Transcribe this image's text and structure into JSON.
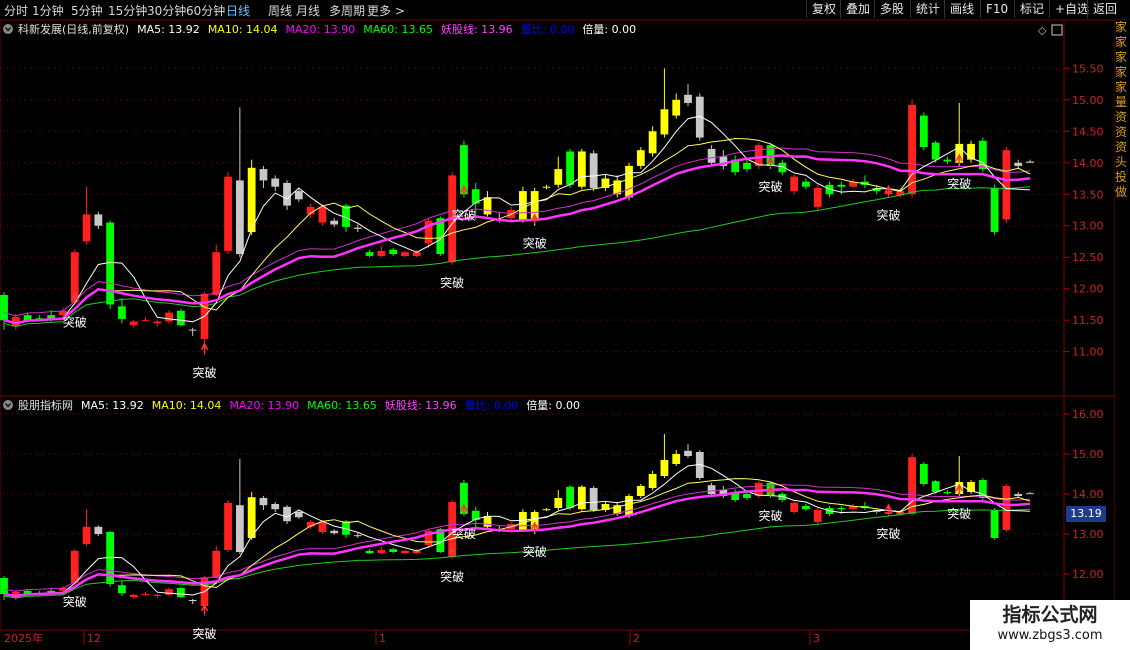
{
  "toolbar": {
    "periods": [
      "分时",
      "1分钟",
      "5分钟",
      "15分钟",
      "30分钟",
      "60分钟",
      "日线",
      "周线",
      "月线",
      "多周期",
      "更多 >"
    ],
    "active_period": "日线",
    "right_buttons": [
      "复权",
      "叠加",
      "多股",
      "统计",
      "画线",
      "F10",
      "标记",
      "+自选",
      "返回"
    ]
  },
  "main_panel": {
    "title": "科新发展(日线,前复权)",
    "indicators": [
      {
        "label": "MA5: 13.92",
        "color": "#ffffff"
      },
      {
        "label": "MA10: 14.04",
        "color": "#ffff00"
      },
      {
        "label": "MA20: 13.90",
        "color": "#ff00ff"
      },
      {
        "label": "MA60: 13.65",
        "color": "#00ff00"
      },
      {
        "label": "妖股线: 13.96",
        "color": "#ff44ff"
      },
      {
        "label": "量比: 0.00",
        "color": "#0000ff"
      },
      {
        "label": "倍量: 0.00",
        "color": "#ffffff"
      }
    ],
    "y_ticks": [
      "15.50",
      "15.00",
      "14.50",
      "14.00",
      "13.50",
      "13.00",
      "12.50",
      "12.00",
      "11.50",
      "11.00"
    ]
  },
  "sub_panel": {
    "title": "股朋指标网",
    "indicators": [
      {
        "label": "MA5: 13.92",
        "color": "#ffffff"
      },
      {
        "label": "MA10: 14.04",
        "color": "#ffff00"
      },
      {
        "label": "MA20: 13.90",
        "color": "#ff00ff"
      },
      {
        "label": "MA60: 13.65",
        "color": "#00ff00"
      },
      {
        "label": "妖股线: 13.96",
        "color": "#ff44ff"
      },
      {
        "label": "量比: 0.00",
        "color": "#0000ff"
      },
      {
        "label": "倍量: 0.00",
        "color": "#ffffff"
      }
    ],
    "y_ticks": [
      "16.00",
      "15.00",
      "14.00",
      "13.00",
      "12.00"
    ],
    "price_tag": "13.19"
  },
  "breakout_label": "突破",
  "x_axis": {
    "year_label": "2025年",
    "months": [
      "12",
      "1",
      "2",
      "3"
    ]
  },
  "side_text": [
    "家",
    "家",
    "家",
    "家",
    "家",
    "量",
    "资",
    "资",
    "资",
    "头",
    "投",
    "做"
  ],
  "watermark": {
    "line1": "指标公式网",
    "line2": "www.zbgs3.com"
  },
  "chart_data": {
    "type": "candlestick",
    "candles": [
      [
        11.9,
        11.5,
        11.95,
        11.35,
        "g"
      ],
      [
        11.55,
        11.4,
        11.6,
        11.35,
        "r"
      ],
      [
        11.5,
        11.58,
        11.62,
        11.48,
        "g"
      ],
      [
        11.53,
        11.52,
        11.58,
        11.5,
        "g"
      ],
      [
        11.52,
        11.58,
        11.66,
        11.48,
        "g"
      ],
      [
        11.65,
        11.58,
        11.7,
        11.55,
        "r"
      ],
      [
        11.78,
        12.58,
        12.62,
        11.75,
        "r"
      ],
      [
        12.75,
        13.18,
        13.62,
        12.7,
        "r"
      ],
      [
        13.18,
        13.0,
        13.22,
        12.95,
        "w"
      ],
      [
        13.05,
        11.75,
        13.08,
        11.68,
        "g"
      ],
      [
        11.72,
        11.52,
        11.85,
        11.45,
        "g"
      ],
      [
        11.42,
        11.48,
        11.5,
        11.38,
        "r"
      ],
      [
        11.5,
        11.5,
        11.55,
        11.48,
        "r"
      ],
      [
        11.45,
        11.48,
        11.5,
        11.4,
        "r"
      ],
      [
        11.48,
        11.62,
        11.66,
        11.45,
        "r"
      ],
      [
        11.65,
        11.42,
        11.68,
        11.4,
        "g"
      ],
      [
        11.35,
        11.35,
        11.38,
        11.25,
        "w"
      ],
      [
        11.2,
        11.92,
        11.95,
        10.95,
        "r"
      ],
      [
        11.9,
        12.58,
        12.7,
        11.88,
        "r"
      ],
      [
        12.6,
        13.78,
        13.85,
        12.55,
        "r"
      ],
      [
        13.72,
        12.55,
        14.88,
        12.5,
        "w"
      ],
      [
        12.9,
        13.92,
        14.05,
        12.85,
        "y"
      ],
      [
        13.9,
        13.72,
        13.95,
        13.6,
        "w"
      ],
      [
        13.75,
        13.62,
        13.8,
        13.55,
        "w"
      ],
      [
        13.68,
        13.32,
        13.72,
        13.25,
        "w"
      ],
      [
        13.55,
        13.42,
        13.58,
        13.38,
        "w"
      ],
      [
        13.3,
        13.18,
        13.35,
        13.12,
        "r"
      ],
      [
        13.3,
        13.05,
        13.35,
        13.0,
        "r"
      ],
      [
        13.08,
        13.02,
        13.12,
        12.98,
        "w"
      ],
      [
        13.32,
        12.98,
        13.35,
        12.9,
        "g"
      ],
      [
        12.95,
        12.97,
        13.02,
        12.9,
        "w"
      ],
      [
        12.52,
        12.58,
        12.62,
        12.5,
        "g"
      ],
      [
        12.52,
        12.6,
        12.68,
        12.5,
        "r"
      ],
      [
        12.62,
        12.55,
        12.65,
        12.52,
        "g"
      ],
      [
        12.52,
        12.58,
        12.6,
        12.5,
        "r"
      ],
      [
        12.52,
        12.58,
        12.62,
        12.5,
        "r"
      ],
      [
        12.72,
        13.08,
        13.12,
        12.65,
        "r"
      ],
      [
        12.55,
        13.12,
        13.15,
        12.52,
        "g"
      ],
      [
        12.42,
        13.8,
        13.85,
        12.38,
        "r"
      ],
      [
        14.28,
        13.5,
        14.35,
        13.45,
        "g"
      ],
      [
        13.58,
        13.35,
        13.68,
        13.1,
        "g"
      ],
      [
        13.18,
        13.45,
        13.55,
        13.15,
        "y"
      ],
      [
        13.1,
        13.1,
        13.22,
        13.05,
        "w"
      ],
      [
        13.12,
        13.25,
        13.3,
        13.08,
        "r"
      ],
      [
        13.1,
        13.55,
        13.62,
        13.05,
        "y"
      ],
      [
        13.1,
        13.55,
        13.6,
        13.0,
        "y"
      ],
      [
        13.62,
        13.62,
        13.65,
        13.58,
        "y"
      ],
      [
        13.65,
        13.9,
        14.1,
        13.6,
        "y"
      ],
      [
        14.18,
        13.65,
        14.22,
        13.6,
        "g"
      ],
      [
        13.62,
        14.18,
        14.22,
        13.58,
        "y"
      ],
      [
        14.15,
        13.6,
        14.2,
        13.55,
        "w"
      ],
      [
        13.6,
        13.75,
        13.82,
        13.55,
        "y"
      ],
      [
        13.5,
        13.72,
        13.8,
        13.45,
        "y"
      ],
      [
        13.45,
        13.95,
        14.0,
        13.4,
        "y"
      ],
      [
        13.95,
        14.2,
        14.25,
        13.9,
        "y"
      ],
      [
        14.15,
        14.5,
        14.58,
        14.1,
        "y"
      ],
      [
        14.45,
        14.85,
        15.5,
        14.4,
        "y"
      ],
      [
        14.75,
        15.0,
        15.1,
        14.7,
        "y"
      ],
      [
        15.08,
        14.95,
        15.25,
        14.9,
        "w"
      ],
      [
        15.05,
        14.4,
        15.1,
        14.35,
        "w"
      ],
      [
        14.22,
        14.0,
        14.28,
        13.95,
        "w"
      ],
      [
        14.1,
        13.95,
        14.2,
        13.9,
        "w"
      ],
      [
        13.85,
        14.05,
        14.12,
        13.8,
        "g"
      ],
      [
        14.0,
        13.9,
        14.05,
        13.85,
        "g"
      ],
      [
        14.28,
        13.95,
        14.32,
        13.9,
        "r"
      ],
      [
        14.28,
        13.95,
        14.3,
        13.9,
        "g"
      ],
      [
        14.0,
        13.85,
        14.05,
        13.8,
        "g"
      ],
      [
        13.78,
        13.55,
        13.82,
        13.5,
        "r"
      ],
      [
        13.62,
        13.7,
        13.75,
        13.58,
        "g"
      ],
      [
        13.6,
        13.3,
        13.65,
        13.25,
        "r"
      ],
      [
        13.65,
        13.5,
        13.7,
        13.45,
        "g"
      ],
      [
        13.65,
        13.62,
        13.7,
        13.5,
        "g"
      ],
      [
        13.7,
        13.62,
        13.75,
        13.6,
        "r"
      ],
      [
        13.7,
        13.65,
        13.8,
        13.6,
        "g"
      ],
      [
        13.6,
        13.55,
        13.65,
        13.5,
        "g"
      ],
      [
        13.55,
        13.5,
        13.6,
        13.45,
        "r"
      ],
      [
        13.55,
        13.48,
        13.6,
        13.45,
        "r"
      ],
      [
        13.5,
        14.92,
        15.0,
        13.45,
        "r"
      ],
      [
        14.75,
        14.25,
        14.8,
        14.2,
        "g"
      ],
      [
        14.32,
        14.05,
        14.35,
        14.0,
        "g"
      ],
      [
        14.05,
        14.02,
        14.1,
        13.98,
        "g"
      ],
      [
        14.3,
        14.0,
        14.95,
        13.95,
        "y"
      ],
      [
        14.3,
        14.05,
        14.35,
        14.0,
        "y"
      ],
      [
        14.35,
        13.9,
        14.4,
        13.85,
        "g"
      ],
      [
        13.6,
        12.9,
        13.65,
        12.85,
        "g"
      ],
      [
        14.2,
        13.1,
        14.25,
        13.05,
        "r"
      ],
      [
        14.0,
        13.95,
        14.05,
        13.9,
        "w"
      ],
      [
        14.02,
        14.0,
        14.05,
        14.0,
        "w"
      ]
    ],
    "breakouts": [
      {
        "candle": 6,
        "label": "突破"
      },
      {
        "candle": 17,
        "label": "突破"
      },
      {
        "candle": 38,
        "label": "突破"
      },
      {
        "candle": 39,
        "label": "突破"
      },
      {
        "candle": 45,
        "label": "突破"
      },
      {
        "candle": 65,
        "label": "突破"
      },
      {
        "candle": 75,
        "label": "突破"
      },
      {
        "candle": 81,
        "label": "突破"
      }
    ],
    "main_ylim": [
      10.55,
      15.95
    ],
    "sub_ylim": [
      11.6,
      16.1
    ]
  }
}
